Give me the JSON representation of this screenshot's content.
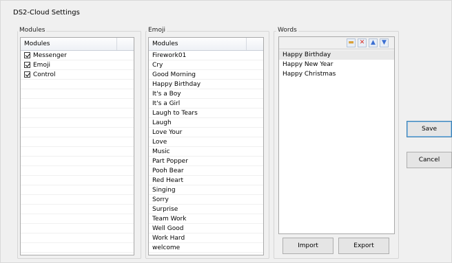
{
  "window": {
    "title": "DS2-Cloud Settings"
  },
  "modules": {
    "group_label": "Modules",
    "header": "Modules",
    "items": [
      {
        "label": "Messenger",
        "checked": true
      },
      {
        "label": "Emoji",
        "checked": true
      },
      {
        "label": "Control",
        "checked": true
      }
    ]
  },
  "emoji": {
    "group_label": "Emoji",
    "header": "Modules",
    "items": [
      "Firework01",
      "Cry",
      "Good Morning",
      "Happy Birthday",
      "It's a Boy",
      "It's a Girl",
      "Laugh to Tears",
      "Laugh",
      "Love Your",
      "Love",
      "Music",
      "Part Popper",
      "Pooh Bear",
      "Red Heart",
      "Singing",
      "Sorry",
      "Surprise",
      "Team Work",
      "Well Good",
      "Work Hard",
      "welcome"
    ]
  },
  "words": {
    "group_label": "Words",
    "toolbar": [
      {
        "icon": "open-folder-icon",
        "glyph": "▬",
        "color": "#d9a13a"
      },
      {
        "icon": "delete-icon",
        "glyph": "✕",
        "color": "#d9261c"
      },
      {
        "icon": "move-up-icon",
        "glyph": "▲",
        "color": "#3b6fd1"
      },
      {
        "icon": "move-down-icon",
        "glyph": "▼",
        "color": "#3b6fd1"
      }
    ],
    "items": [
      "Happy Birthday",
      "Happy New Year",
      "Happy Christmas"
    ],
    "selected_index": 0,
    "import_label": "Import",
    "export_label": "Export"
  },
  "actions": {
    "save_label": "Save",
    "cancel_label": "Cancel"
  }
}
